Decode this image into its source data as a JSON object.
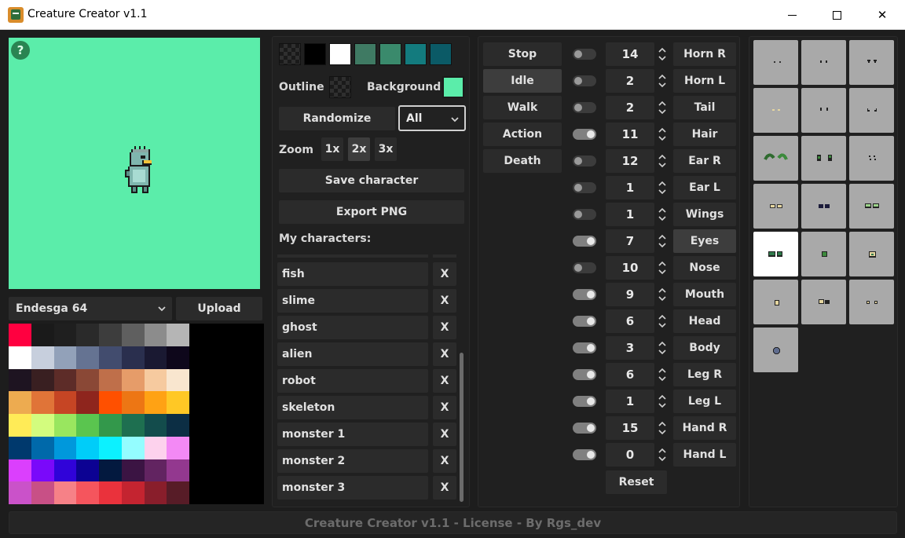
{
  "window": {
    "title": "Creature Creator v1.1",
    "min_icon": "minimize-icon",
    "max_icon": "maximize-icon",
    "close_glyph": "✕"
  },
  "preview": {
    "background_color": "#5bedaa",
    "help_glyph": "?"
  },
  "palette": {
    "selected": "Endesga 64",
    "upload_label": "Upload",
    "swatches": [
      "#ff0040",
      "#1a1a1a",
      "#1f1f1f",
      "#2a2a2a",
      "#3d3d3d",
      "#5f5f5f",
      "#8c8c8c",
      "#b5b5b5",
      "#ffffff",
      "#c7cfdd",
      "#92a1b9",
      "#657392",
      "#424c6e",
      "#2a2f4e",
      "#1a1932",
      "#0e071b",
      "#1e1421",
      "#391f21",
      "#5d2c28",
      "#8a4836",
      "#bf6f4a",
      "#e69c69",
      "#f6ca9f",
      "#f9e6cf",
      "#edab50",
      "#e07438",
      "#c64524",
      "#8e251d",
      "#ff5000",
      "#ed7614",
      "#ffa214",
      "#ffc825",
      "#ffeb57",
      "#d3fc7e",
      "#99e65f",
      "#5ac54f",
      "#33984b",
      "#1e6f50",
      "#134c4c",
      "#0c2e44",
      "#00396d",
      "#0069aa",
      "#0098dc",
      "#00cdf9",
      "#0cf1ff",
      "#94fdff",
      "#fdd2ed",
      "#f389f5",
      "#db3ffd",
      "#7a09fa",
      "#3003d9",
      "#0c0293",
      "#03193f",
      "#3b1443",
      "#622461",
      "#93388f",
      "#ca52c9",
      "#c85086",
      "#f68187",
      "#f5555d",
      "#ea323c",
      "#c42430",
      "#891e2b",
      "#571c27"
    ]
  },
  "colors": {
    "swatches": [
      "transparent",
      "#000000",
      "#ffffff",
      "#3f7a63",
      "#3a8a6c",
      "#137b7e",
      "#0b5a66"
    ],
    "outline_label": "Outline",
    "background_label": "Background",
    "background_color": "#5bedaa",
    "randomize_label": "Randomize",
    "randomize_scope": "All",
    "zoom_label": "Zoom",
    "zoom_options": [
      "1x",
      "2x",
      "3x"
    ],
    "zoom_selected": "2x",
    "save_label": "Save character",
    "export_label": "Export PNG",
    "my_characters_label": "My characters:"
  },
  "characters": [
    {
      "name": "fish",
      "delete": "X"
    },
    {
      "name": "slime",
      "delete": "X"
    },
    {
      "name": "ghost",
      "delete": "X"
    },
    {
      "name": "alien",
      "delete": "X"
    },
    {
      "name": "robot",
      "delete": "X"
    },
    {
      "name": "skeleton",
      "delete": "X"
    },
    {
      "name": "monster 1",
      "delete": "X"
    },
    {
      "name": "monster 2",
      "delete": "X"
    },
    {
      "name": "monster 3",
      "delete": "X"
    }
  ],
  "animations": [
    {
      "label": "Stop",
      "active": false
    },
    {
      "label": "Idle",
      "active": true
    },
    {
      "label": "Walk",
      "active": false
    },
    {
      "label": "Action",
      "active": false
    },
    {
      "label": "Death",
      "active": false
    }
  ],
  "parts": [
    {
      "label": "Horn R",
      "value": "14",
      "enabled": false,
      "active": false
    },
    {
      "label": "Horn L",
      "value": "2",
      "enabled": false,
      "active": false
    },
    {
      "label": "Tail",
      "value": "2",
      "enabled": false,
      "active": false
    },
    {
      "label": "Hair",
      "value": "11",
      "enabled": true,
      "active": false
    },
    {
      "label": "Ear R",
      "value": "12",
      "enabled": false,
      "active": false
    },
    {
      "label": "Ear L",
      "value": "1",
      "enabled": false,
      "active": false
    },
    {
      "label": "Wings",
      "value": "1",
      "enabled": false,
      "active": false
    },
    {
      "label": "Eyes",
      "value": "7",
      "enabled": true,
      "active": true
    },
    {
      "label": "Nose",
      "value": "10",
      "enabled": false,
      "active": false
    },
    {
      "label": "Mouth",
      "value": "9",
      "enabled": true,
      "active": false
    },
    {
      "label": "Head",
      "value": "6",
      "enabled": true,
      "active": false
    },
    {
      "label": "Body",
      "value": "3",
      "enabled": true,
      "active": false
    },
    {
      "label": "Leg R",
      "value": "6",
      "enabled": true,
      "active": false
    },
    {
      "label": "Leg L",
      "value": "1",
      "enabled": true,
      "active": false
    },
    {
      "label": "Hand R",
      "value": "15",
      "enabled": true,
      "active": false
    },
    {
      "label": "Hand L",
      "value": "0",
      "enabled": true,
      "active": false
    }
  ],
  "reset_label": "Reset",
  "tiles": {
    "count": 19,
    "selected_index": 12
  },
  "footer": "Creature Creator v1.1 - License - By Rgs_dev"
}
